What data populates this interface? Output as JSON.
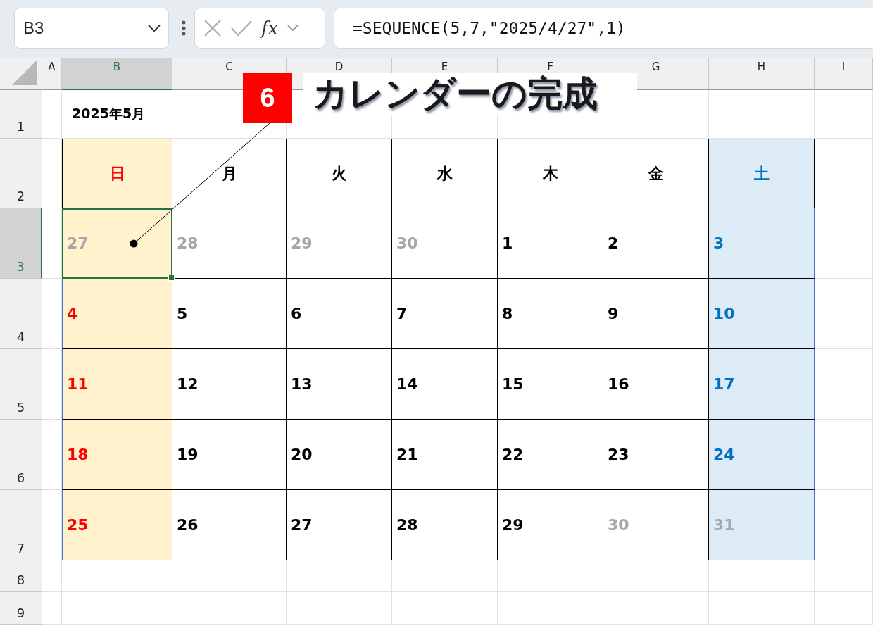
{
  "formula_bar": {
    "name_box": "B3",
    "function_label": "fx",
    "formula": "=SEQUENCE(5,7,\"2025/4/27\",1)"
  },
  "columns": [
    {
      "label": "A",
      "selected": false
    },
    {
      "label": "B",
      "selected": true
    },
    {
      "label": "C",
      "selected": false
    },
    {
      "label": "D",
      "selected": false
    },
    {
      "label": "E",
      "selected": false
    },
    {
      "label": "F",
      "selected": false
    },
    {
      "label": "G",
      "selected": false
    },
    {
      "label": "H",
      "selected": false
    },
    {
      "label": "I",
      "selected": false
    }
  ],
  "rows": [
    {
      "label": "1",
      "selected": false
    },
    {
      "label": "2",
      "selected": false
    },
    {
      "label": "3",
      "selected": true
    },
    {
      "label": "4",
      "selected": false
    },
    {
      "label": "5",
      "selected": false
    },
    {
      "label": "6",
      "selected": false
    },
    {
      "label": "7",
      "selected": false
    },
    {
      "label": "8",
      "selected": false
    },
    {
      "label": "9",
      "selected": false
    }
  ],
  "title_cell": "2025年5月",
  "weekdays": [
    {
      "label": "日",
      "color": "#ff0000"
    },
    {
      "label": "月",
      "color": "#000000"
    },
    {
      "label": "火",
      "color": "#000000"
    },
    {
      "label": "水",
      "color": "#000000"
    },
    {
      "label": "木",
      "color": "#000000"
    },
    {
      "label": "金",
      "color": "#000000"
    },
    {
      "label": "土",
      "color": "#0070c0"
    }
  ],
  "weeks": [
    [
      {
        "text": "27",
        "muted": true,
        "selected": true
      },
      {
        "text": "28",
        "muted": true,
        "selected": false
      },
      {
        "text": "29",
        "muted": true,
        "selected": false
      },
      {
        "text": "30",
        "muted": true,
        "selected": false
      },
      {
        "text": "1",
        "muted": false,
        "selected": false
      },
      {
        "text": "2",
        "muted": false,
        "selected": false
      },
      {
        "text": "3",
        "muted": false,
        "selected": false
      }
    ],
    [
      {
        "text": "4",
        "muted": false,
        "selected": false
      },
      {
        "text": "5",
        "muted": false,
        "selected": false
      },
      {
        "text": "6",
        "muted": false,
        "selected": false
      },
      {
        "text": "7",
        "muted": false,
        "selected": false
      },
      {
        "text": "8",
        "muted": false,
        "selected": false
      },
      {
        "text": "9",
        "muted": false,
        "selected": false
      },
      {
        "text": "10",
        "muted": false,
        "selected": false
      }
    ],
    [
      {
        "text": "11",
        "muted": false,
        "selected": false
      },
      {
        "text": "12",
        "muted": false,
        "selected": false
      },
      {
        "text": "13",
        "muted": false,
        "selected": false
      },
      {
        "text": "14",
        "muted": false,
        "selected": false
      },
      {
        "text": "15",
        "muted": false,
        "selected": false
      },
      {
        "text": "16",
        "muted": false,
        "selected": false
      },
      {
        "text": "17",
        "muted": false,
        "selected": false
      }
    ],
    [
      {
        "text": "18",
        "muted": false,
        "selected": false
      },
      {
        "text": "19",
        "muted": false,
        "selected": false
      },
      {
        "text": "20",
        "muted": false,
        "selected": false
      },
      {
        "text": "21",
        "muted": false,
        "selected": false
      },
      {
        "text": "22",
        "muted": false,
        "selected": false
      },
      {
        "text": "23",
        "muted": false,
        "selected": false
      },
      {
        "text": "24",
        "muted": false,
        "selected": false
      }
    ],
    [
      {
        "text": "25",
        "muted": false,
        "selected": false
      },
      {
        "text": "26",
        "muted": false,
        "selected": false
      },
      {
        "text": "27",
        "muted": false,
        "selected": false
      },
      {
        "text": "28",
        "muted": false,
        "selected": false
      },
      {
        "text": "29",
        "muted": false,
        "selected": false
      },
      {
        "text": "30",
        "muted": true,
        "selected": false
      },
      {
        "text": "31",
        "muted": true,
        "selected": false
      }
    ]
  ],
  "callout": {
    "number": "6",
    "text": "カレンダーの完成"
  }
}
